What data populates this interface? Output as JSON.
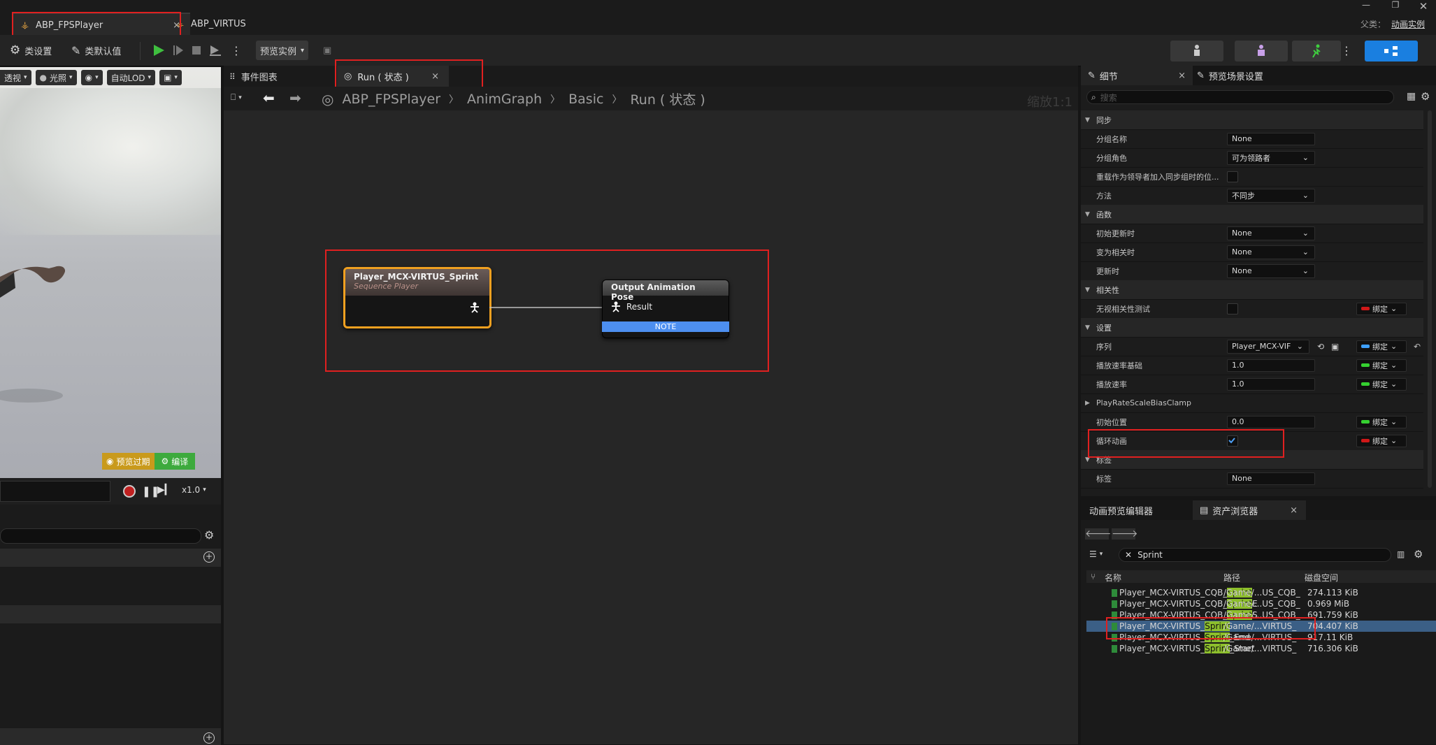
{
  "title_bar": {
    "tabs": [
      {
        "label": "ABP_FPSPlayer",
        "close": "×"
      },
      {
        "label": "ABP_VIRTUS"
      }
    ],
    "parent_label": "父类：",
    "parent_value": "动画实例"
  },
  "toolbar": {
    "class_settings": "类设置",
    "class_defaults": "类默认值",
    "preview_instance": "预览实例"
  },
  "viewport": {
    "perspective": "透视",
    "lighting": "光照",
    "lod": "自动LOD",
    "preview_expired": "预览过期",
    "compile": "编译",
    "speed": "x1.0"
  },
  "graph": {
    "tabs": [
      {
        "label": "事件图表"
      },
      {
        "label": "Run ( 状态 )",
        "close": "×"
      }
    ],
    "breadcrumb": [
      "ABP_FPSPlayer",
      "AnimGraph",
      "Basic",
      "Run ( 状态 )"
    ],
    "zoom": "缩放1:1",
    "seq_node": {
      "title": "Player_MCX-VIRTUS_Sprint",
      "subtitle": "Sequence Player"
    },
    "out_node": {
      "title": "Output Animation Pose",
      "pin": "Result",
      "note": "NOTE"
    }
  },
  "details": {
    "tabs": [
      {
        "label": "细节",
        "close": "×"
      },
      {
        "label": "预览场景设置"
      }
    ],
    "search_placeholder": "搜索",
    "rows": [
      {
        "type": "cat",
        "label": "同步"
      },
      {
        "type": "text",
        "label": "分组名称",
        "value": "None"
      },
      {
        "type": "combo",
        "label": "分组角色",
        "value": "可为领路者"
      },
      {
        "type": "check",
        "label": "重载作为领导者加入同步组时的位..."
      },
      {
        "type": "combo",
        "label": "方法",
        "value": "不同步"
      },
      {
        "type": "cat",
        "label": "函数"
      },
      {
        "type": "combo",
        "label": "初始更新时",
        "value": "None"
      },
      {
        "type": "combo",
        "label": "变为相关时",
        "value": "None"
      },
      {
        "type": "combo",
        "label": "更新时",
        "value": "None"
      },
      {
        "type": "cat",
        "label": "相关性"
      },
      {
        "type": "check",
        "label": "无视相关性测试",
        "bind": "绑定",
        "bind_color": "#d01818"
      },
      {
        "type": "cat",
        "label": "设置"
      },
      {
        "type": "asset",
        "label": "序列",
        "value": "Player_MCX-VIF",
        "bind": "绑定",
        "bind_color": "#3ea0ff"
      },
      {
        "type": "text",
        "label": "播放速率基础",
        "value": "1.0",
        "bind": "绑定",
        "bind_color": "#35d030"
      },
      {
        "type": "text",
        "label": "播放速率",
        "value": "1.0",
        "bind": "绑定",
        "bind_color": "#35d030"
      },
      {
        "type": "group",
        "label": "PlayRateScaleBiasClamp"
      },
      {
        "type": "text",
        "label": "初始位置",
        "value": "0.0",
        "bind": "绑定",
        "bind_color": "#35d030"
      },
      {
        "type": "checked",
        "label": "循环动画",
        "bind": "绑定",
        "bind_color": "#d01818"
      },
      {
        "type": "cat",
        "label": "标签"
      },
      {
        "type": "text",
        "label": "标签",
        "value": "None"
      }
    ]
  },
  "content_browser": {
    "tabs": [
      {
        "label": "动画预览编辑器"
      },
      {
        "label": "资产浏览器",
        "close": "×"
      }
    ],
    "search_value": "Sprint",
    "columns": [
      "名称",
      "路径",
      "磁盘空间"
    ],
    "rows": [
      {
        "pre": "Player_MCX-VIRTUS_CQB_",
        "hl": "Sprint",
        "post": "",
        "path": "/Game/...US_CQB_",
        "size": "274.113 KiB"
      },
      {
        "pre": "Player_MCX-VIRTUS_CQB_",
        "hl": "Sprint",
        "post": "E",
        "path": "/Game/...US_CQB_",
        "size": "0.969 MiB"
      },
      {
        "pre": "Player_MCX-VIRTUS_CQB_",
        "hl": "Sprint",
        "post": "S",
        "path": "/Game/...US_CQB_",
        "size": "691.759 KiB"
      },
      {
        "pre": "Player_MCX-VIRTUS_",
        "hl": "Sprint",
        "post": "",
        "path": "/Game/...VIRTUS_",
        "size": "704.407 KiB",
        "selected": true
      },
      {
        "pre": "Player_MCX-VIRTUS_",
        "hl": "Sprint",
        "post": "_End",
        "path": "/Game/...VIRTUS_",
        "size": "917.11 KiB"
      },
      {
        "pre": "Player_MCX-VIRTUS_",
        "hl": "Sprint",
        "post": "_Start",
        "path": "/Game/...VIRTUS_",
        "size": "716.306 KiB"
      }
    ]
  },
  "colors": {
    "accent": "#1a7fe0",
    "node_highlight": "#f0a020",
    "note_bar": "#4d8ff0",
    "annotation": "#e02020"
  }
}
